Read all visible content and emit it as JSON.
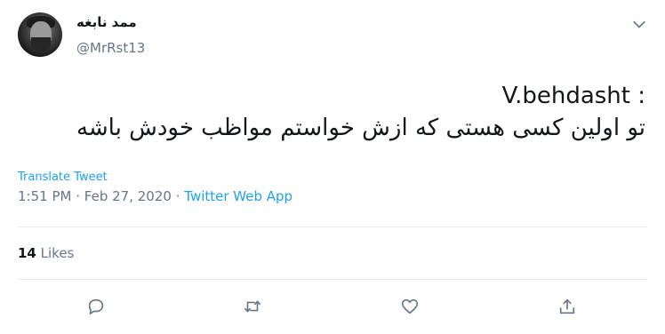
{
  "author": {
    "display_name": "ممد نابغه",
    "handle": "@MrRst13"
  },
  "tweet": {
    "line1": "V.behdasht :",
    "line2": "تو اولین کسی هستی که ازش خواستم مواظب خودش باشه"
  },
  "translate_label": "Translate Tweet",
  "meta": {
    "time": "1:51 PM",
    "separator": "·",
    "date": "Feb 27, 2020",
    "source": "Twitter Web App"
  },
  "stats": {
    "likes_count": "14",
    "likes_label": "Likes"
  },
  "icons": {
    "caret": "chevron-down-icon",
    "reply": "reply-icon",
    "retweet": "retweet-icon",
    "like": "heart-icon",
    "share": "share-icon"
  },
  "colors": {
    "accent": "#1da1f2",
    "secondary_text": "#657786",
    "icon": "#657786"
  }
}
